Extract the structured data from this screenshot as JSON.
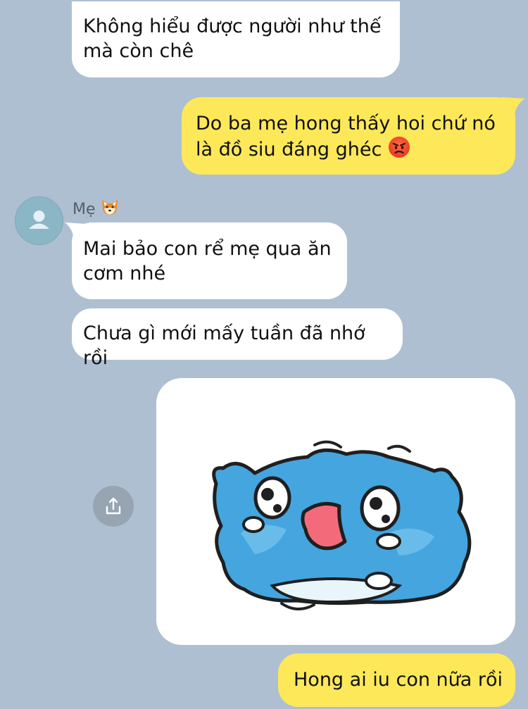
{
  "messages": [
    {
      "id": "m1",
      "side": "incoming",
      "text": "Không hiểu được người như thế mà còn chê"
    },
    {
      "id": "m2",
      "side": "outgoing",
      "text": "Do ba mẹ hong thấy hoi chứ nó là đồ siu đáng ghéc",
      "emoji": "angry-face"
    },
    {
      "id": "m3",
      "side": "incoming",
      "text": "Mai bảo con rể mẹ qua ăn cơm nhé"
    },
    {
      "id": "m4",
      "side": "incoming",
      "text": "Chưa gì mới mấy tuần đã nhớ rồi"
    },
    {
      "id": "m5",
      "side": "outgoing",
      "text": "Hong ai iu con nữa rồi"
    }
  ],
  "sender": {
    "name": "Mẹ",
    "emoji": "fox-face"
  },
  "sticker": {
    "icon": "crying-blue-cat-sticker"
  },
  "colors": {
    "background": "#aebfd1",
    "incoming": "#ffffff",
    "outgoing": "#fde85a"
  }
}
